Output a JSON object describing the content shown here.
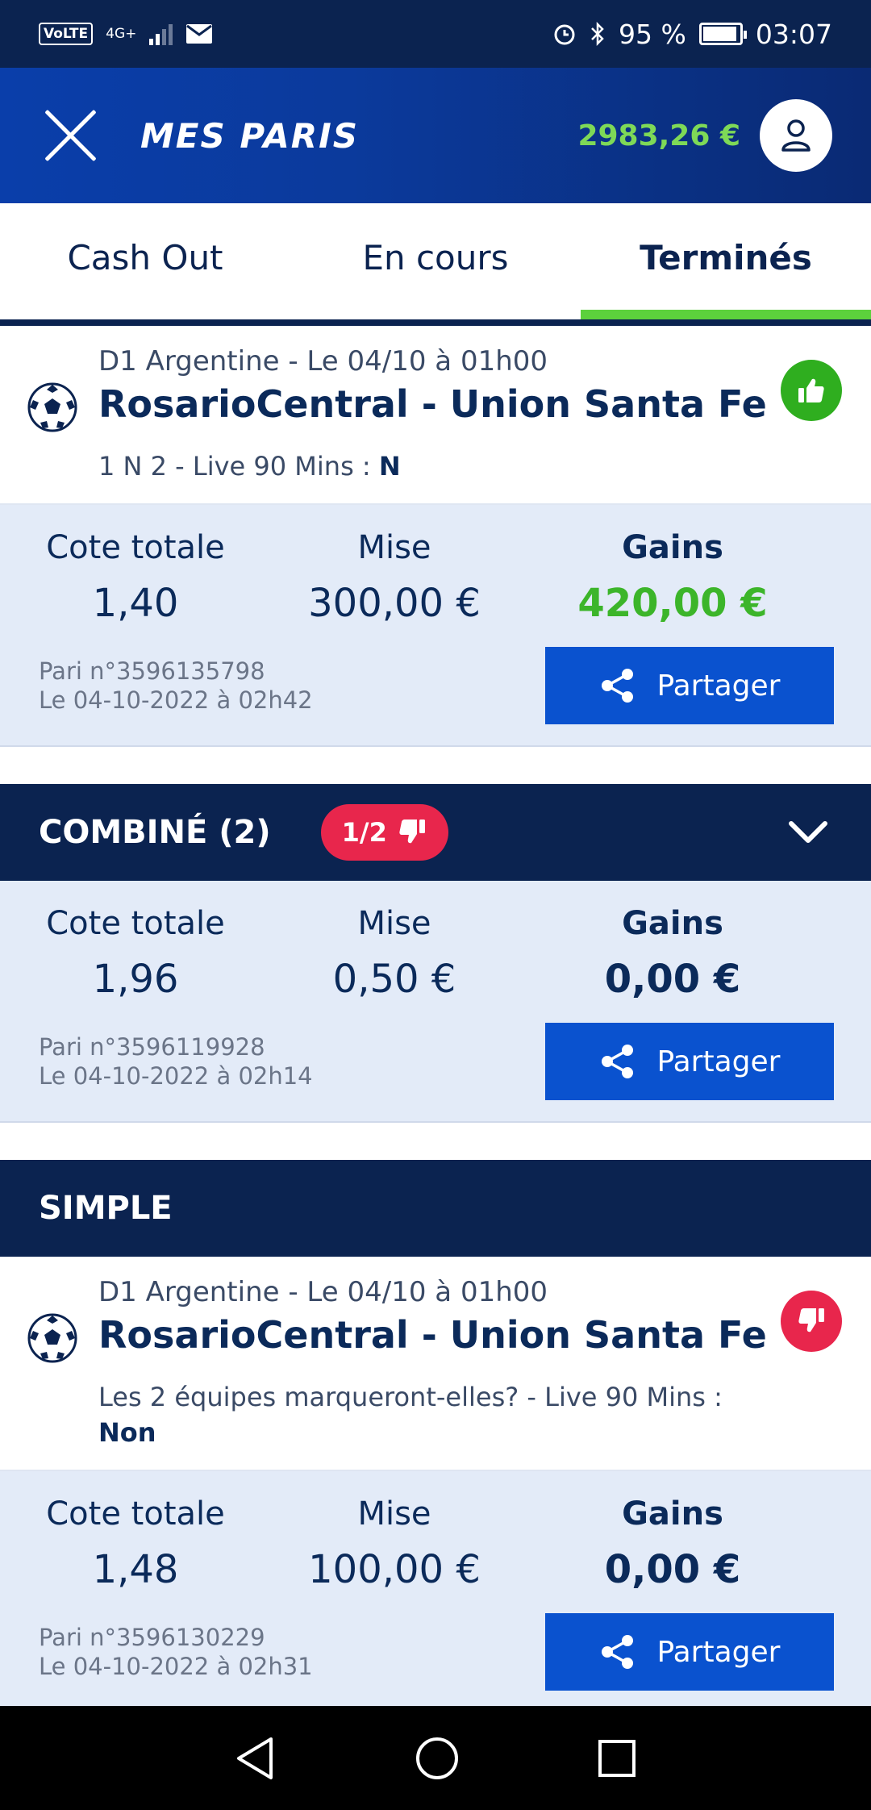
{
  "status_bar": {
    "volte": "VoLTE",
    "network": "4G+",
    "battery": "95 %",
    "battery_level": 0.95,
    "time": "03:07"
  },
  "header": {
    "title": "MES PARIS",
    "balance": "2983,26 €",
    "close_icon": "close-icon",
    "account_icon": "user-icon"
  },
  "tabs": [
    {
      "label": "Cash Out",
      "active": false
    },
    {
      "label": "En cours",
      "active": false
    },
    {
      "label": "Terminés",
      "active": true
    }
  ],
  "bet1": {
    "league": "D1 Argentine - Le 04/10 à 01h00",
    "teams": "RosarioCentral - Union Santa Fe",
    "market": "1 N 2 - Live 90 Mins : ",
    "selection": "N",
    "result": "win",
    "odds_label": "Cote totale",
    "odds": "1,40",
    "stake_label": "Mise",
    "stake": "300,00 €",
    "gains_label": "Gains",
    "gains": "420,00 €",
    "bet_id": "Pari n°3596135798",
    "date": "Le 04-10-2022 à 02h42",
    "share_label": "Partager"
  },
  "combo": {
    "title": "COMBINÉ (2)",
    "badge": "1/2",
    "odds_label": "Cote totale",
    "odds": "1,96",
    "stake_label": "Mise",
    "stake": "0,50 €",
    "gains_label": "Gains",
    "gains": "0,00 €",
    "bet_id": "Pari n°3596119928",
    "date": "Le 04-10-2022 à 02h14",
    "share_label": "Partager"
  },
  "simple": {
    "title": "SIMPLE",
    "league": "D1 Argentine - Le 04/10 à 01h00",
    "teams": "RosarioCentral - Union Santa Fe",
    "market": "Les 2 équipes marqueront-elles? - Live 90 Mins : ",
    "selection": "Non",
    "result": "loss",
    "odds_label": "Cote totale",
    "odds": "1,48",
    "stake_label": "Mise",
    "stake": "100,00 €",
    "gains_label": "Gains",
    "gains": "0,00 €",
    "bet_id": "Pari n°3596130229",
    "date": "Le 04-10-2022 à 02h31",
    "share_label": "Partager"
  },
  "colors": {
    "navy": "#0b2350",
    "blue": "#0a52cf",
    "green": "#5cd13c",
    "red": "#e8264c"
  }
}
